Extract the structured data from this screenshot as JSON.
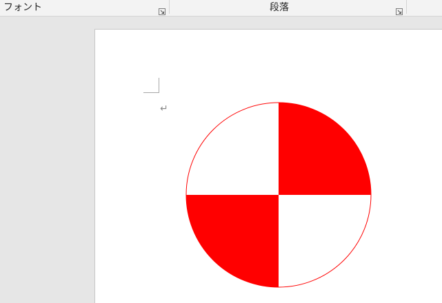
{
  "ribbon": {
    "groups": [
      {
        "label": "フォント",
        "launcher_icon": "dialog-launcher-icon"
      },
      {
        "label": "段落",
        "launcher_icon": "dialog-launcher-icon"
      }
    ]
  },
  "document": {
    "paragraph_mark": "↵",
    "shape": {
      "type": "quartered-circle",
      "fill_color": "#ff0000",
      "alt_fill_color": "#ffffff",
      "outline_color": "#ff0000",
      "filled_quadrants": [
        "top-right",
        "bottom-left"
      ]
    }
  }
}
